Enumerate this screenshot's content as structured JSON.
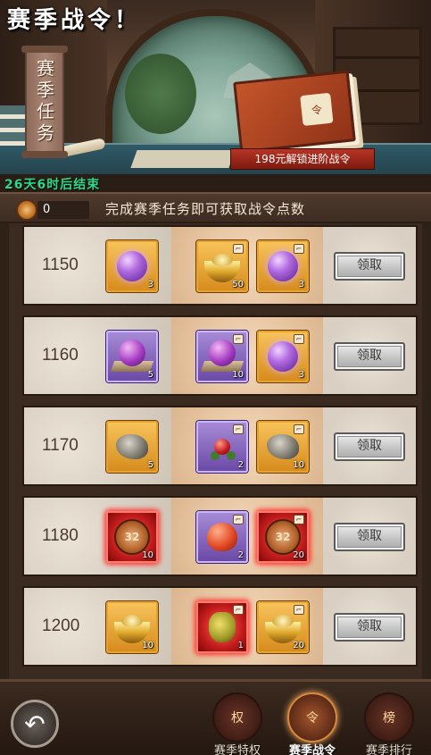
{
  "header": {
    "title": "赛季战令！",
    "banner": "赛季任务",
    "promo": "198元解锁进阶战令",
    "countdown": "26天6时后结束",
    "book_emblem": "令"
  },
  "infobar": {
    "points": "0",
    "hint": "完成赛季任务即可获取战令点数"
  },
  "rows": [
    {
      "level": "1150",
      "free": {
        "icon": "taiji-orb-icon",
        "qty": "3"
      },
      "adv": [
        {
          "icon": "gold-ingot-icon",
          "qty": "50"
        },
        {
          "icon": "taiji-orb-icon",
          "qty": "3"
        }
      ],
      "button": "领取"
    },
    {
      "level": "1160",
      "free": {
        "icon": "purple-orb-icon",
        "qty": "5"
      },
      "adv": [
        {
          "icon": "purple-orb-icon",
          "qty": "10"
        },
        {
          "icon": "taiji-orb-icon",
          "qty": "3"
        }
      ],
      "button": "领取"
    },
    {
      "level": "1170",
      "free": {
        "icon": "ore-rock-icon",
        "qty": "5"
      },
      "adv": [
        {
          "icon": "red-berry-icon",
          "qty": "2"
        },
        {
          "icon": "ore-rock-icon",
          "qty": "10"
        }
      ],
      "button": "领取"
    },
    {
      "level": "1180",
      "free": {
        "icon": "copper-coin-icon",
        "qty": "10"
      },
      "adv": [
        {
          "icon": "peach-icon",
          "qty": "2"
        },
        {
          "icon": "copper-coin-icon",
          "qty": "20"
        }
      ],
      "button": "领取"
    },
    {
      "level": "1200",
      "free": {
        "icon": "gold-ingot-icon",
        "qty": "10"
      },
      "adv": [
        {
          "icon": "lucky-bag-icon",
          "qty": "1"
        },
        {
          "icon": "gold-ingot-icon",
          "qty": "20"
        }
      ],
      "button": "领取"
    }
  ],
  "coin_text": "32",
  "bottom": {
    "back": "↶",
    "tabs": [
      {
        "label": "赛季特权",
        "glyph": "权"
      },
      {
        "label": "赛季战令",
        "glyph": "令"
      },
      {
        "label": "赛季排行",
        "glyph": "榜"
      }
    ]
  },
  "colors": {
    "countdown": "#2cd98a",
    "promo_bg": "#b73424",
    "item_gold_border": "#e8a32a",
    "item_red_glow": "#ff3030"
  }
}
